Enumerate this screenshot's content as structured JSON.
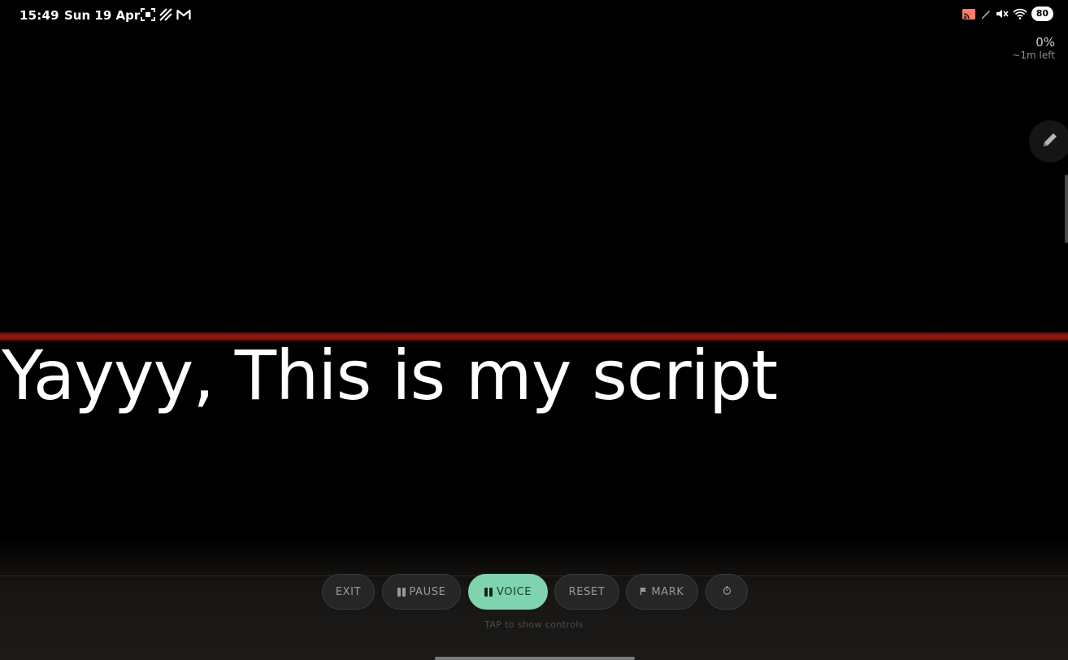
{
  "status_bar": {
    "time": "15:49",
    "date": "Sun 19 Apr",
    "left_icons": [
      "screenshot-icon",
      "hatched-icon",
      "gmail-icon"
    ],
    "right_icons": [
      "cast-icon",
      "pen-icon",
      "mute-icon",
      "wifi-icon"
    ],
    "battery": "80"
  },
  "progress": {
    "percent": "0%",
    "time_left": "~1m left"
  },
  "edit": {
    "icon": "pencil-icon"
  },
  "script": {
    "text": "Yayyy, This is my script"
  },
  "guide_line_color": "#9c180f",
  "controls": {
    "exit_label": "EXIT",
    "pause_label": "PAUSE",
    "voice_label": "VOICE",
    "reset_label": "RESET",
    "mark_label": "MARK",
    "mark_icon": "flag-icon",
    "timer_icon": "timer-icon",
    "accent_color": "#7fd4ae"
  },
  "hint": "TAP to show controls"
}
